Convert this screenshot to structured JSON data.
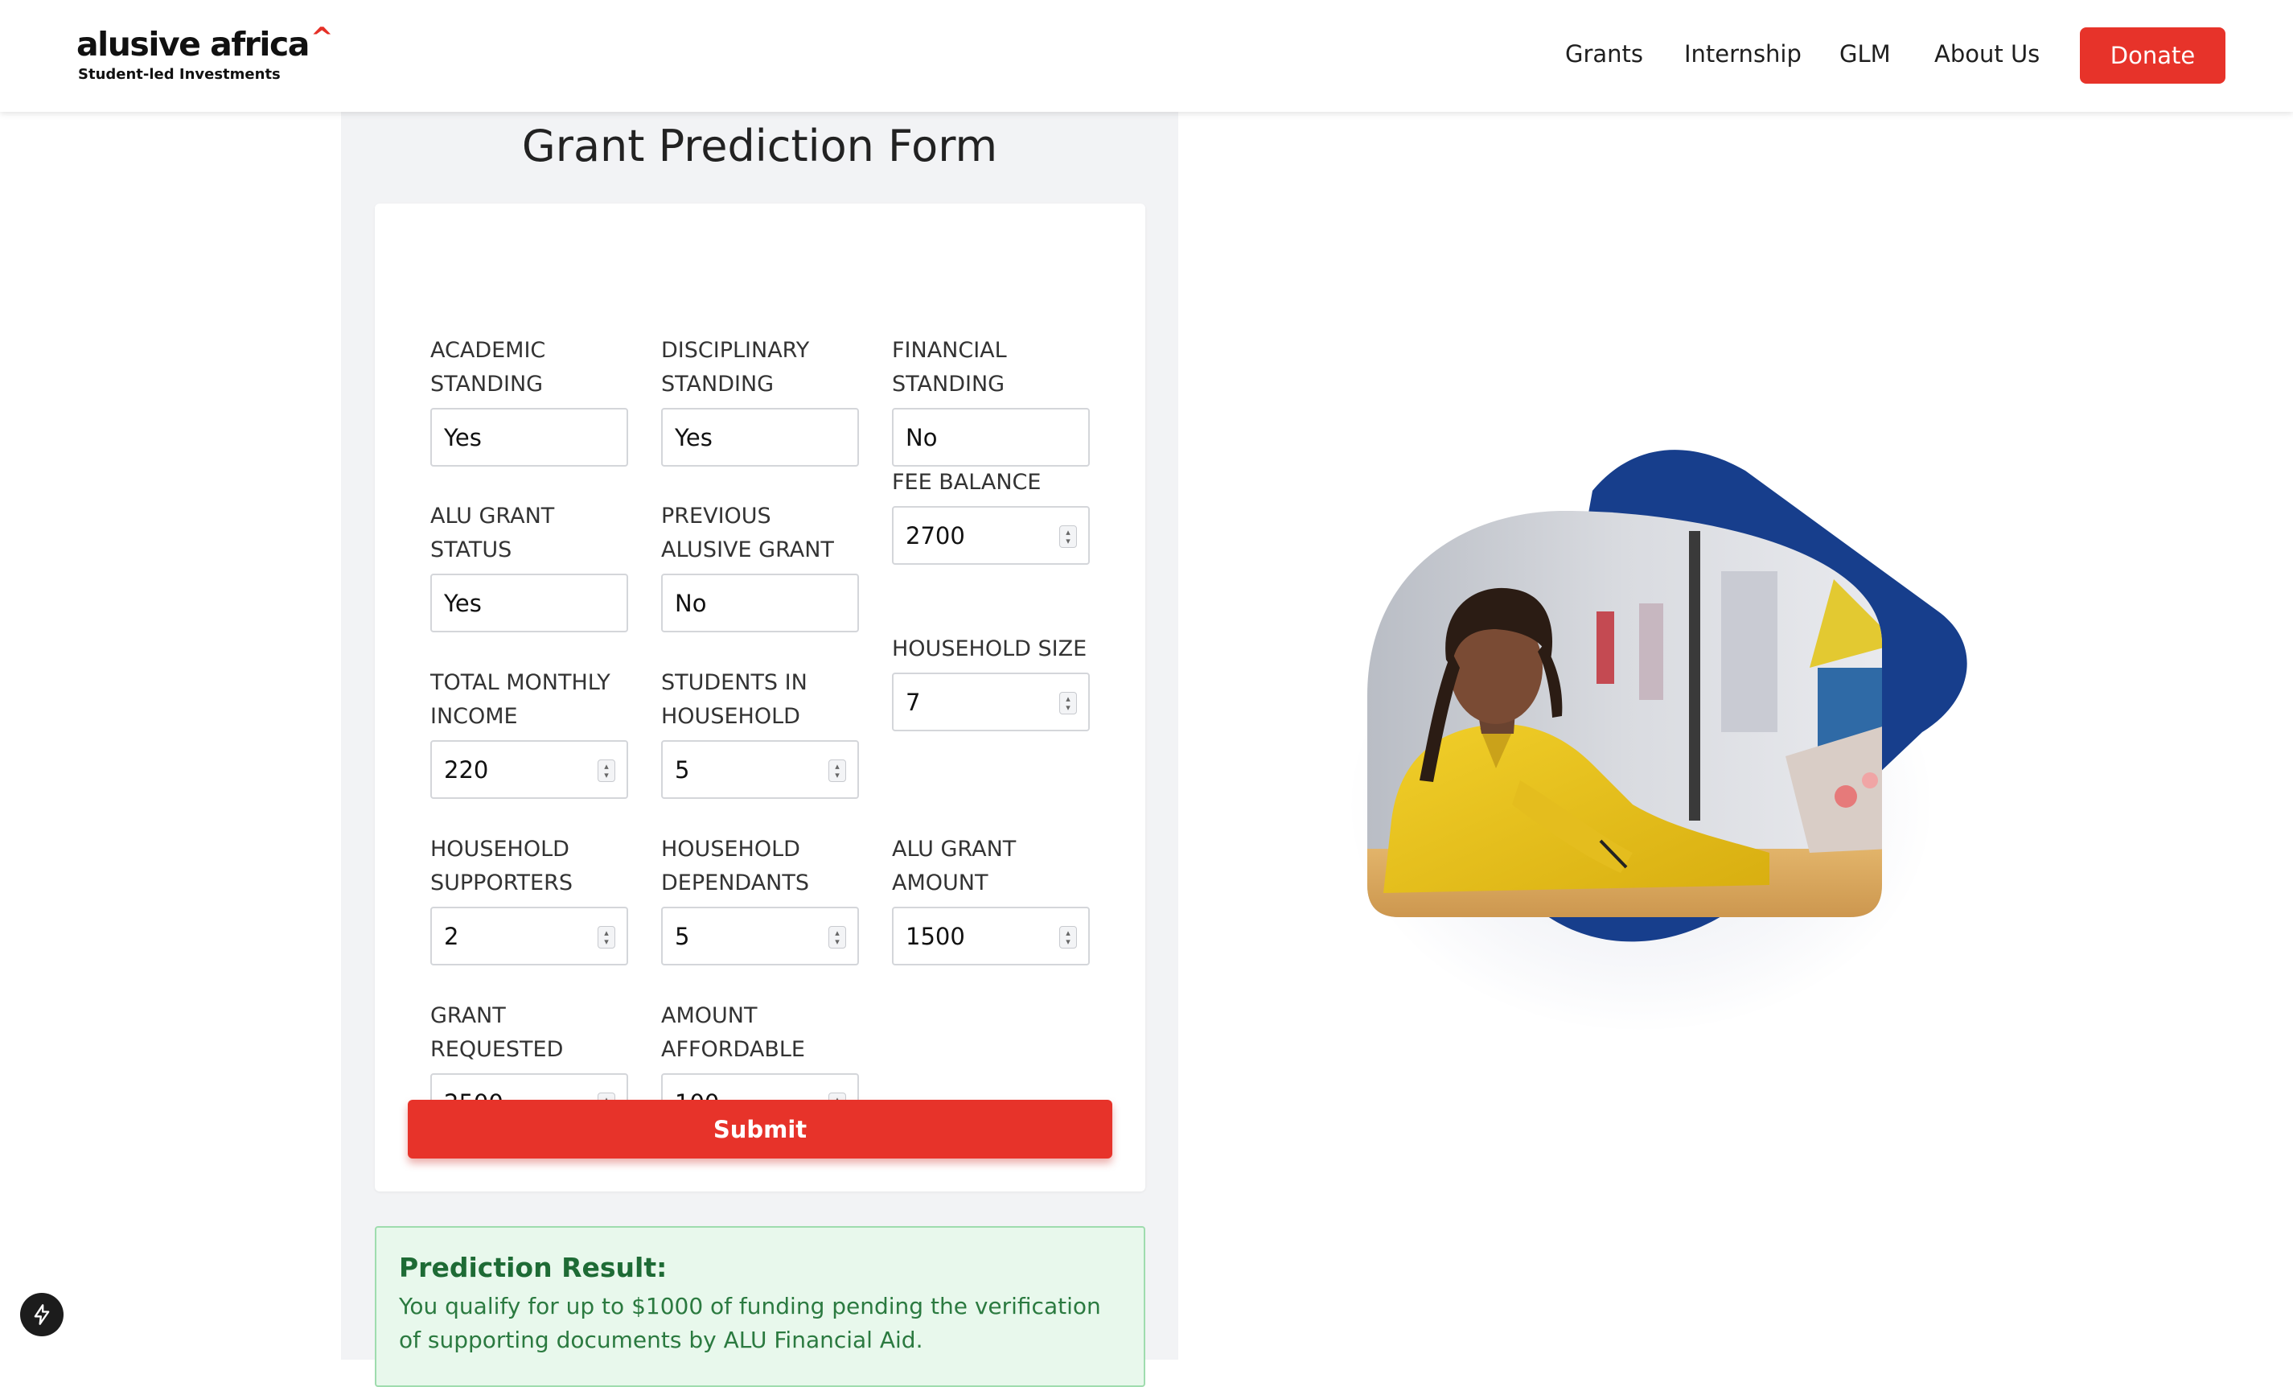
{
  "brand": {
    "name": "alusive africa",
    "caret": "^",
    "tagline": "Student-led Investments",
    "accent_color": "#e7332a"
  },
  "nav": {
    "links": [
      "Grants",
      "Internship",
      "GLM",
      "About Us"
    ],
    "donate_label": "Donate"
  },
  "form": {
    "title": "Grant Prediction Form",
    "fields": [
      {
        "label": "ACADEMIC STANDING",
        "value": "Yes",
        "type": "select"
      },
      {
        "label": "DISCIPLINARY STANDING",
        "value": "Yes",
        "type": "select"
      },
      {
        "label": "FINANCIAL STANDING",
        "value": "No",
        "type": "select"
      },
      {
        "label": "ALU GRANT STATUS",
        "value": "Yes",
        "type": "select"
      },
      {
        "label": "PREVIOUS ALUSIVE GRANT",
        "value": "No",
        "type": "select"
      },
      {
        "label": "FEE BALANCE",
        "value": "2700",
        "type": "number"
      },
      {
        "label": "TOTAL MONTHLY INCOME",
        "value": "220",
        "type": "number"
      },
      {
        "label": "STUDENTS IN HOUSEHOLD",
        "value": "5",
        "type": "number"
      },
      {
        "label": "HOUSEHOLD SIZE",
        "value": "7",
        "type": "number"
      },
      {
        "label": "HOUSEHOLD SUPPORTERS",
        "value": "2",
        "type": "number"
      },
      {
        "label": "HOUSEHOLD DEPENDANTS",
        "value": "5",
        "type": "number"
      },
      {
        "label": "ALU GRANT AMOUNT",
        "value": "1500",
        "type": "number"
      },
      {
        "label": "GRANT REQUESTED",
        "value": "2500",
        "type": "number"
      },
      {
        "label": "AMOUNT AFFORDABLE",
        "value": "100",
        "type": "number"
      }
    ],
    "submit_label": "Submit"
  },
  "result": {
    "title": "Prediction Result:",
    "text": "You qualify for up to $1000 of funding pending the verification of supporting documents by ALU Financial Aid."
  },
  "illustration": {
    "blob_color": "#173e8c",
    "subject": "student in yellow shirt writing at desk"
  },
  "icons": {
    "bolt": "lightning-bolt-icon",
    "spinner": "number-spinner-icon"
  }
}
